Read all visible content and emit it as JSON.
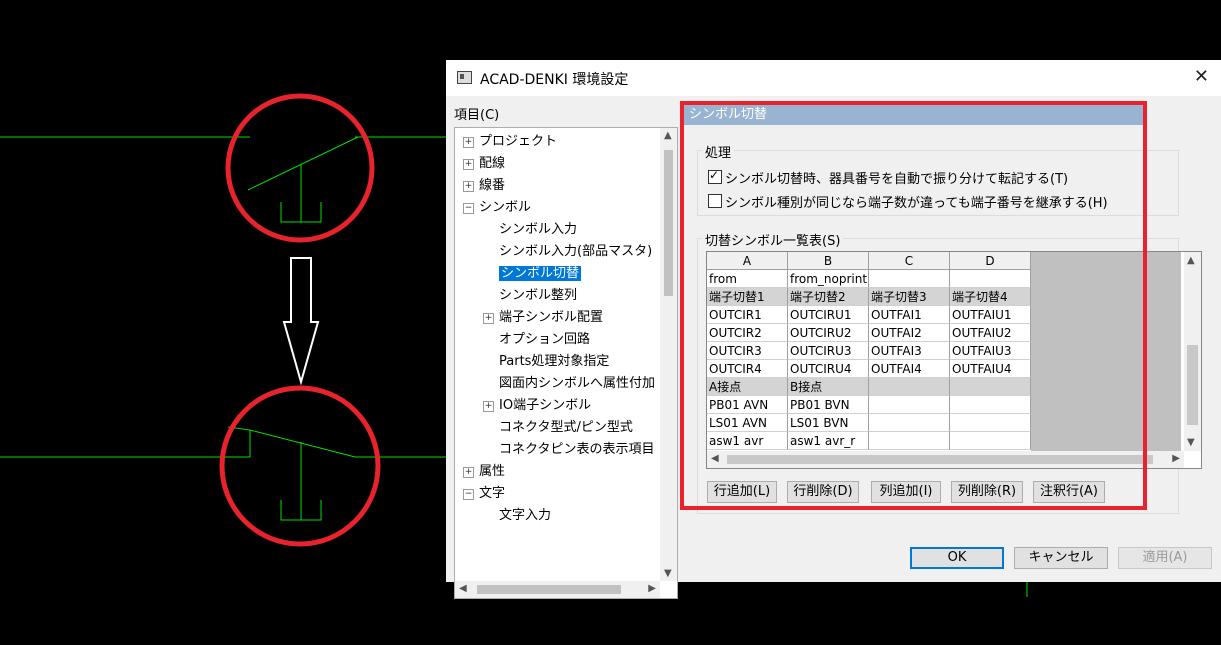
{
  "window": {
    "title": "ACAD-DENKI 環境設定",
    "close": "✕"
  },
  "tree": {
    "label": "項目(C)",
    "items": [
      {
        "label": "プロジェクト",
        "level": 0,
        "expander": "+"
      },
      {
        "label": "配線",
        "level": 0,
        "expander": "+"
      },
      {
        "label": "線番",
        "level": 0,
        "expander": "+"
      },
      {
        "label": "シンボル",
        "level": 0,
        "expander": "−"
      },
      {
        "label": "シンボル入力",
        "level": 1
      },
      {
        "label": "シンボル入力(部品マスタ)",
        "level": 1
      },
      {
        "label": "シンボル切替",
        "level": 1,
        "selected": true
      },
      {
        "label": "シンボル整列",
        "level": 1
      },
      {
        "label": "端子シンボル配置",
        "level": 1,
        "expander": "+"
      },
      {
        "label": "オプション回路",
        "level": 1
      },
      {
        "label": "Parts処理対象指定",
        "level": 1
      },
      {
        "label": "図面内シンボルへ属性付加",
        "level": 1
      },
      {
        "label": "IO端子シンボル",
        "level": 1,
        "expander": "+"
      },
      {
        "label": "コネクタ型式/ピン型式",
        "level": 1
      },
      {
        "label": "コネクタピン表の表示項目",
        "level": 1
      },
      {
        "label": "属性",
        "level": 0,
        "expander": "+"
      },
      {
        "label": "文字",
        "level": 0,
        "expander": "−"
      },
      {
        "label": "文字入力",
        "level": 1
      }
    ]
  },
  "panel": {
    "header": "シンボル切替",
    "process_group": {
      "title": "処理",
      "options": [
        {
          "label": "シンボル切替時、器具番号を自動で振り分けて転記する(T)",
          "checked": true
        },
        {
          "label": "シンボル種別が同じなら端子数が違っても端子番号を継承する(H)",
          "checked": false
        }
      ]
    },
    "table_group": {
      "title": "切替シンボル一覧表(S)",
      "columns": [
        "A",
        "B",
        "C",
        "D"
      ],
      "rows": [
        {
          "cells": [
            "from",
            "from_noprint",
            "",
            ""
          ],
          "gray": false
        },
        {
          "cells": [
            "端子切替1",
            "端子切替2",
            "端子切替3",
            "端子切替4"
          ],
          "gray": true
        },
        {
          "cells": [
            "OUTCIR1",
            "OUTCIRU1",
            "OUTFAI1",
            "OUTFAIU1"
          ],
          "gray": false
        },
        {
          "cells": [
            "OUTCIR2",
            "OUTCIRU2",
            "OUTFAI2",
            "OUTFAIU2"
          ],
          "gray": false
        },
        {
          "cells": [
            "OUTCIR3",
            "OUTCIRU3",
            "OUTFAI3",
            "OUTFAIU3"
          ],
          "gray": false
        },
        {
          "cells": [
            "OUTCIR4",
            "OUTCIRU4",
            "OUTFAI4",
            "OUTFAIU4"
          ],
          "gray": false
        },
        {
          "cells": [
            "A接点",
            "B接点",
            "",
            ""
          ],
          "gray": true
        },
        {
          "cells": [
            "PB01 AVN",
            "PB01 BVN",
            "",
            ""
          ],
          "gray": false
        },
        {
          "cells": [
            "LS01 AVN",
            "LS01 BVN",
            "",
            ""
          ],
          "gray": false
        },
        {
          "cells": [
            "asw1 avr",
            "asw1 avr_r",
            "",
            ""
          ],
          "gray": false
        }
      ]
    },
    "buttons": [
      "行追加(L)",
      "行削除(D)",
      "列追加(I)",
      "列削除(R)",
      "注釈行(A)"
    ]
  },
  "footer": {
    "ok": "OK",
    "cancel": "キャンセル",
    "apply": "適用(A)"
  },
  "colors": {
    "accent": "#0078d7",
    "header": "#99b4d1",
    "highlight": "#e8232b",
    "cad_line": "#00e000"
  }
}
